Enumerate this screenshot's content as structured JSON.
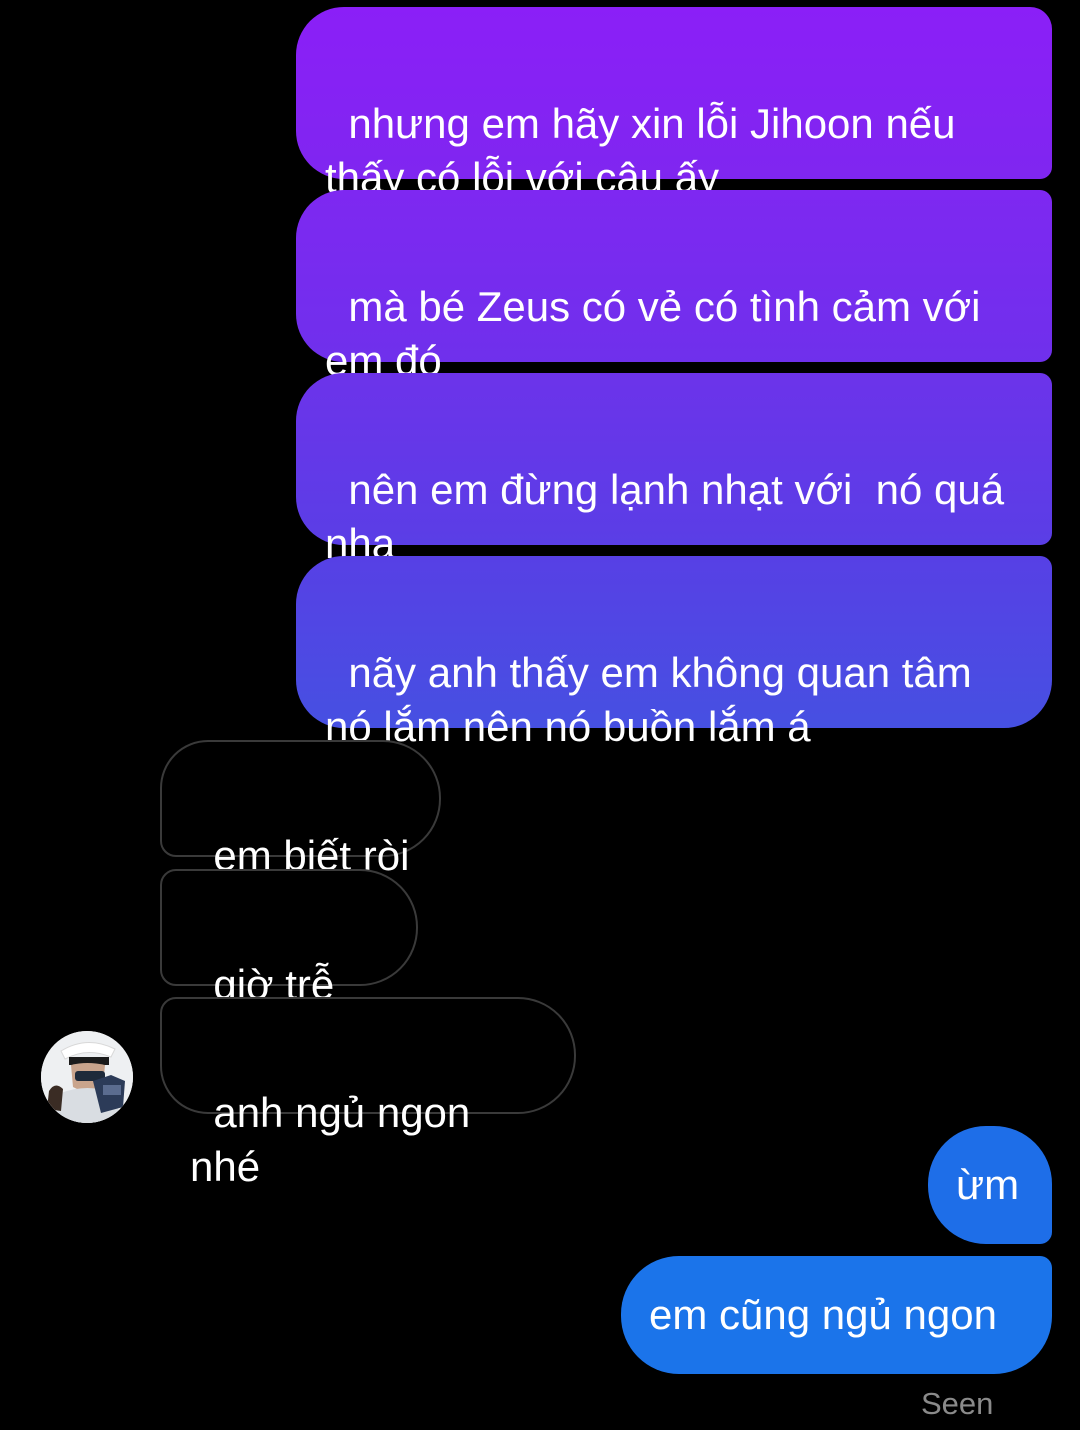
{
  "messages": [
    {
      "sender": "me",
      "text": "nhưng em hãy xin lỗi Jihoon nếu thấy có lỗi với cậu ấy"
    },
    {
      "sender": "me",
      "text": "mà bé Zeus có vẻ có tình cảm với em đó"
    },
    {
      "sender": "me",
      "text": "nên em đừng lạnh nhạt với  nó quá nha"
    },
    {
      "sender": "me",
      "text": "nãy anh thấy em không quan tâm nó lắm nên nó buồn lắm á"
    },
    {
      "sender": "other",
      "text": "em biết ròi"
    },
    {
      "sender": "other",
      "text": "giờ trễ rồi"
    },
    {
      "sender": "other",
      "text": "anh ngủ ngon nhé"
    },
    {
      "sender": "me",
      "text": "ừm"
    },
    {
      "sender": "me",
      "text": "em cũng ngủ ngon"
    }
  ],
  "status": {
    "seen_label": "Seen"
  },
  "colors": {
    "background": "#000000",
    "sent_gradient_top": "#8a1ff6",
    "sent_gradient_bottom": "#1a73e8",
    "received_border": "#3a3a3a",
    "seen_text": "#8a8a8a"
  },
  "icons": {
    "avatar": "contact-avatar-photo"
  }
}
